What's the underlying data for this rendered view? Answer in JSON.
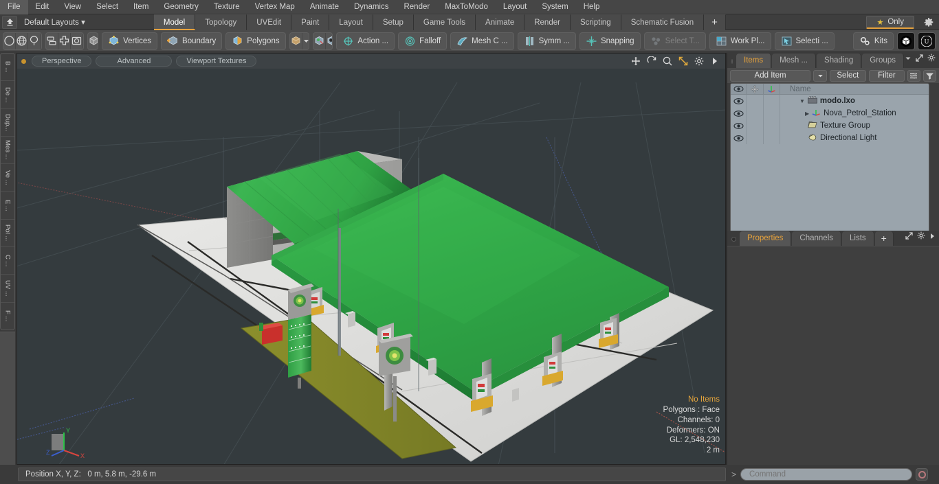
{
  "app": {
    "title": "modo",
    "accent": "#e8a33c",
    "panel_bg": "#3c3c3c",
    "toolbar_bg": "#4b4b4b",
    "viewport_bg": "#343b3e"
  },
  "menubar": {
    "items": [
      "File",
      "Edit",
      "View",
      "Select",
      "Item",
      "Geometry",
      "Texture",
      "Vertex Map",
      "Animate",
      "Dynamics",
      "Render",
      "MaxToModo",
      "Layout",
      "System",
      "Help"
    ]
  },
  "layoutbar": {
    "home_icon": "home-up-icon",
    "layout_name": "Default Layouts",
    "dropdown_caret": "▾",
    "tabs": [
      {
        "label": "Model",
        "active": true
      },
      {
        "label": "Topology",
        "active": false
      },
      {
        "label": "UVEdit",
        "active": false
      },
      {
        "label": "Paint",
        "active": false
      },
      {
        "label": "Layout",
        "active": false
      },
      {
        "label": "Setup",
        "active": false
      },
      {
        "label": "Game Tools",
        "active": false
      },
      {
        "label": "Animate",
        "active": false
      },
      {
        "label": "Render",
        "active": false
      },
      {
        "label": "Scripting",
        "active": false
      },
      {
        "label": "Schematic Fusion",
        "active": false
      }
    ],
    "add_tab_label": "+",
    "only_button": {
      "label": "Only",
      "star_icon": "star-icon"
    },
    "gear_icon": "gear-icon"
  },
  "toolbar": {
    "group1": [
      "circle-select-icon",
      "globe-icon",
      "lasso-icon",
      "paint-select-icon"
    ],
    "group2": [
      "align-icon",
      "center-icon",
      "fit-icon",
      "radial-icon"
    ],
    "group3": [
      "cube-solid-icon"
    ],
    "mode_buttons": [
      {
        "label": "Vertices",
        "icon": "vertices-cube-icon"
      },
      {
        "label": "Boundary",
        "icon": "boundary-cube-icon"
      },
      {
        "label": "Polygons",
        "icon": "polygons-cube-icon"
      }
    ],
    "items_dropdown": {
      "icon": "items-cube-icon",
      "caret": "▾"
    },
    "mini_icons": [
      "cube-green-icon",
      "cube-red-icon"
    ],
    "tools": [
      {
        "label": "Action   ...",
        "icon": "action-center-icon",
        "disabled": false
      },
      {
        "label": "Falloff",
        "icon": "falloff-icon",
        "disabled": false
      },
      {
        "label": "Mesh C ...",
        "icon": "mesh-constraint-icon",
        "disabled": false
      },
      {
        "label": "Symm ...",
        "icon": "symmetry-icon",
        "disabled": false
      },
      {
        "label": "Snapping",
        "icon": "snapping-icon",
        "disabled": false
      },
      {
        "label": "Select T...",
        "icon": "select-through-icon",
        "disabled": true
      },
      {
        "label": "Work Pl...",
        "icon": "work-plane-icon",
        "disabled": false
      },
      {
        "label": "Selecti ...",
        "icon": "selection-arrow-icon",
        "disabled": false
      }
    ],
    "kits": {
      "label": "Kits",
      "icon": "kits-gears-icon"
    },
    "right_icons": [
      "unity-cube-icon",
      "unreal-icon"
    ]
  },
  "left_tabs": {
    "items": [
      "B ...",
      "De ...",
      "Dup...",
      "Mes ...",
      "Ve ...",
      "E ...",
      "Pol ...",
      "C ...",
      "UV ...",
      "F ..."
    ]
  },
  "viewport": {
    "dot": "active-viewport-dot",
    "pills": [
      "Perspective",
      "Advanced",
      "Viewport Textures"
    ],
    "header_icons": [
      "move-icon",
      "rotate-icon",
      "zoom-icon",
      "fit-icon",
      "gear-icon",
      "play-arrow-icon"
    ],
    "axis_gizmo": {
      "x": "X",
      "y": "Y",
      "z": "Z"
    },
    "stats": {
      "selection": "No Items",
      "polygons": "Polygons : Face",
      "channels": "Channels: 0",
      "deformers": "Deformers: ON",
      "gl": "GL: 2,548,230",
      "scale": "2 m"
    },
    "scene_description": "Nova petrol station 3D model: green curved canopy building, green flat forecourt canopy on pillars, fuel pumps, price totem sign, grey concrete pad, olive grass strip"
  },
  "right_panel": {
    "item_tabs": [
      {
        "label": "Items",
        "active": true
      },
      {
        "label": "Mesh ...",
        "active": false
      },
      {
        "label": "Shading",
        "active": false
      },
      {
        "label": "Groups",
        "active": false
      }
    ],
    "item_tab_icons": [
      "chevron-down-icon",
      "expand-icon",
      "gear-icon",
      "play-arrow-icon"
    ],
    "toolrow": {
      "add_item": "Add Item",
      "add_item_caret": "▾",
      "select": "Select",
      "filter": "Filter",
      "list_icon": "list-options-icon",
      "funnel_icon": "funnel-icon"
    },
    "tree": {
      "columns": [
        "eye-icon",
        "move-icon",
        "axis-icon",
        "Name"
      ],
      "rows": [
        {
          "name": "modo.lxo",
          "icon": "scene-clapper-icon",
          "depth": 0,
          "expander": "▼",
          "bold": true
        },
        {
          "name": "Nova_Petrol_Station",
          "icon": "mesh-axis-icon",
          "depth": 1,
          "expander": "▶",
          "bold": false
        },
        {
          "name": "Texture Group",
          "icon": "folder-icon",
          "depth": 1,
          "expander": "",
          "bold": false
        },
        {
          "name": "Directional Light",
          "icon": "light-icon",
          "depth": 1,
          "expander": "",
          "bold": false
        }
      ]
    },
    "props_tabs": [
      {
        "label": "Properties",
        "active": true
      },
      {
        "label": "Channels",
        "active": false
      },
      {
        "label": "Lists",
        "active": false
      },
      {
        "label": "+",
        "active": false
      }
    ],
    "props_tab_icons": [
      "expand-icon",
      "gear-icon",
      "play-arrow-icon"
    ]
  },
  "bottombar": {
    "position_label": "Position X, Y, Z:",
    "position_value": "0 m, 5.8 m, -29.6 m",
    "command_prompt": ">",
    "command_placeholder": "Command",
    "command_value": "",
    "record_icon": "record-circle-icon"
  }
}
